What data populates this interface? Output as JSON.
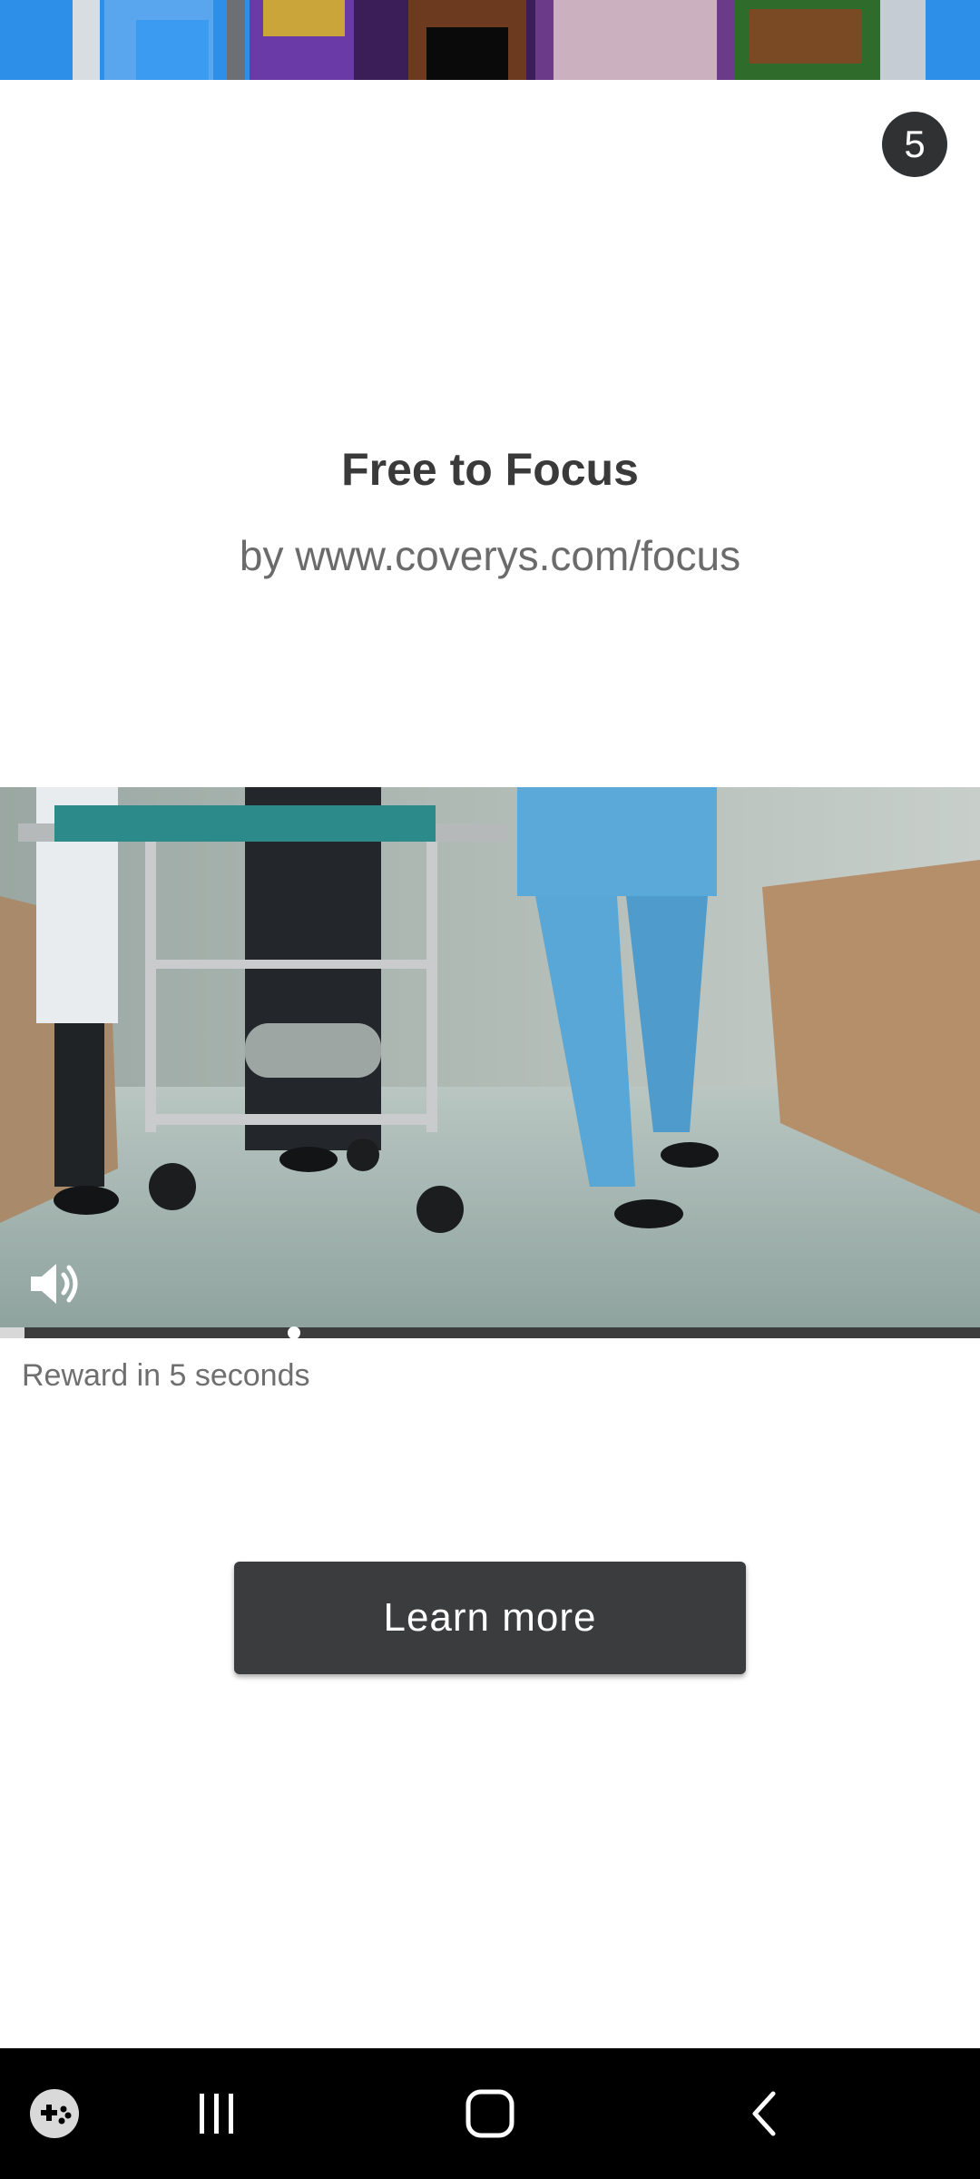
{
  "ad": {
    "countdown": "5",
    "title": "Free to Focus",
    "advertiser": "by www.coverys.com/focus",
    "reward_text": "Reward in 5 seconds",
    "cta_label": "Learn more",
    "video_progress": 0.3
  },
  "icons": {
    "mute": "volume-icon",
    "game_launcher": "game-launcher-icon",
    "recents": "recent-apps-icon",
    "home": "home-icon",
    "back": "back-icon"
  },
  "colors": {
    "cta_background": "#3b3c3e",
    "countdown_background": "#2f3133",
    "top_banner": "#2d8fe8"
  }
}
